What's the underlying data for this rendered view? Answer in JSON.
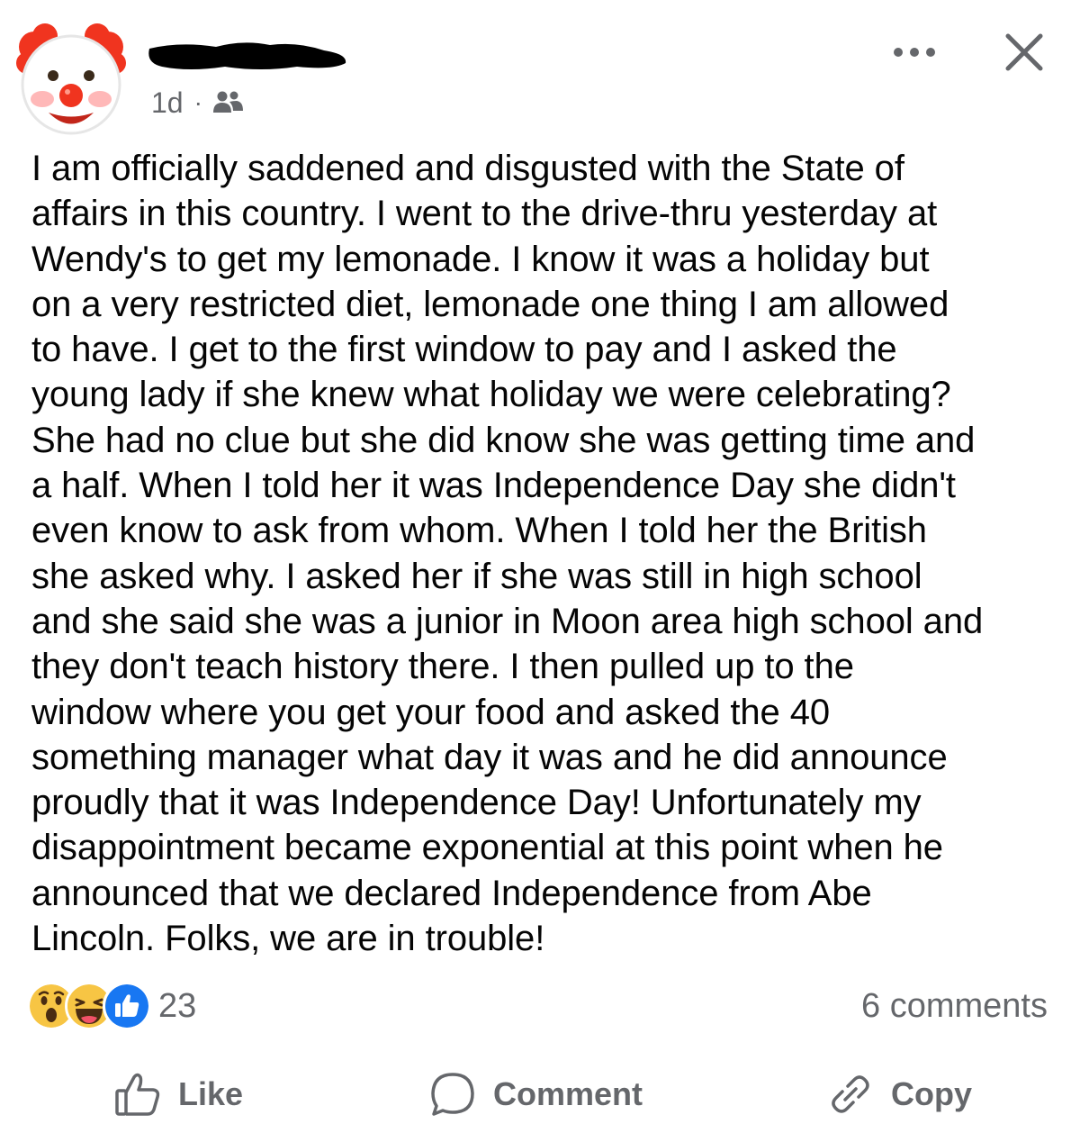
{
  "post": {
    "author_name_redacted": true,
    "time": "1d",
    "separator": "·",
    "audience_icon": "friends-icon",
    "more_icon": "more-options-icon",
    "close_icon": "close-icon",
    "text": "I am officially saddened and disgusted with the State of\naffairs in this country. I went to the drive-thru yesterday at\nWendy's to get my lemonade. I know it was a holiday but\non a very restricted diet, lemonade one thing I am allowed\nto have. I get to the first window to pay and I asked the\nyoung lady if  she knew what holiday we were celebrating?\nShe had no clue but she did know she was getting time and\na half. When I told her it was Independence Day she didn't\neven know to ask from whom. When I told her the British\nshe asked why. I asked her if she was still in high school\nand she said she was a junior in Moon area high school and\nthey don't teach history there. I then pulled up to the\nwindow where you get your food and asked the 40\nsomething manager what day it  was and he did announce\nproudly that it was Independence Day! Unfortunately my\ndisappointment  became exponential at this point when he\nannounced that we declared Independence from Abe\nLincoln. Folks, we are in trouble!"
  },
  "reactions": {
    "icons": [
      "wow-reaction-icon",
      "haha-reaction-icon",
      "like-reaction-icon"
    ],
    "count": "23",
    "comments": "6 comments"
  },
  "actions": {
    "like_label": "Like",
    "comment_label": "Comment",
    "copy_label": "Copy"
  },
  "colors": {
    "text": "#050505",
    "secondary": "#65676b",
    "like_blue": "#1877f2",
    "reaction_yellow": "#f7c544"
  }
}
